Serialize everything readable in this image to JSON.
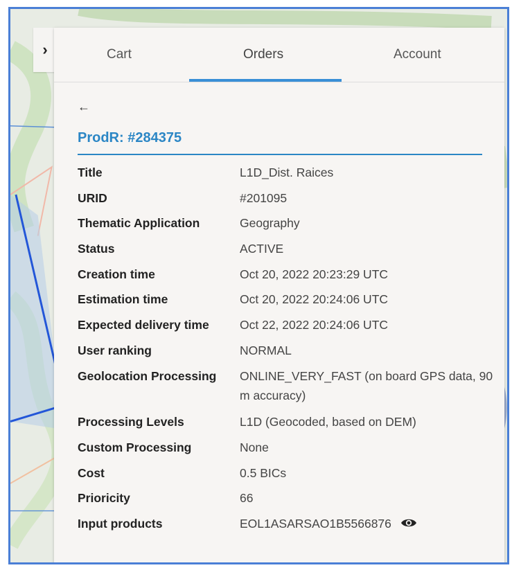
{
  "tabs": {
    "cart": "Cart",
    "orders": "Orders",
    "account": "Account"
  },
  "panel": {
    "collapse_icon": "chevron-right-icon",
    "back_icon": "arrow-left-icon",
    "order_title": "ProdR: #284375"
  },
  "details": [
    {
      "label": "Title",
      "value": "L1D_Dist. Raices"
    },
    {
      "label": "URID",
      "value": "#201095"
    },
    {
      "label": "Thematic Application",
      "value": "Geography"
    },
    {
      "label": "Status",
      "value": "ACTIVE"
    },
    {
      "label": "Creation time",
      "value": "Oct 20, 2022 20:23:29 UTC"
    },
    {
      "label": "Estimation time",
      "value": "Oct 20, 2022 20:24:06 UTC"
    },
    {
      "label": "Expected delivery time",
      "value": "Oct 22, 2022 20:24:06 UTC"
    },
    {
      "label": "User ranking",
      "value": "NORMAL"
    },
    {
      "label": "Geolocation Processing",
      "value": "ONLINE_VERY_FAST (on board GPS data, 90 m accuracy)"
    },
    {
      "label": "Processing Levels",
      "value": "L1D (Geocoded, based on DEM)"
    },
    {
      "label": "Custom Processing",
      "value": "None"
    },
    {
      "label": "Cost",
      "value": "0.5 BICs"
    },
    {
      "label": "Prioricity",
      "value": "66"
    },
    {
      "label": "Input products",
      "value": "EOL1ASARSAO1B5566876",
      "icon": "eye-icon"
    }
  ],
  "colors": {
    "accent": "#2b86c5",
    "tab_indicator": "#3a8fd6",
    "frame_border": "#4a7fd6"
  }
}
